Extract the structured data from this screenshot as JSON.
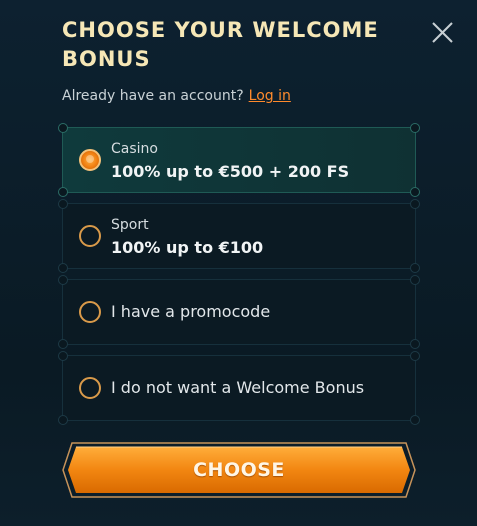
{
  "modal": {
    "title": "CHOOSE YOUR WELCOME BONUS",
    "login_prompt": "Already have an account?",
    "login_link": "Log in"
  },
  "options": [
    {
      "category": "Casino",
      "offer": "100% up to €500 + 200 FS",
      "selected": true
    },
    {
      "category": "Sport",
      "offer": "100% up to €100",
      "selected": false
    },
    {
      "label": "I have a promocode",
      "selected": false
    },
    {
      "label": "I do not want a Welcome Bonus",
      "selected": false
    }
  ],
  "cta": {
    "label": "CHOOSE"
  },
  "colors": {
    "accent_orange": "#f07f12",
    "title_cream": "#f6e7b6",
    "link_orange": "#ff8a2c",
    "selected_bg": "#0f3a3c"
  },
  "icons": {
    "close": "close-icon"
  }
}
